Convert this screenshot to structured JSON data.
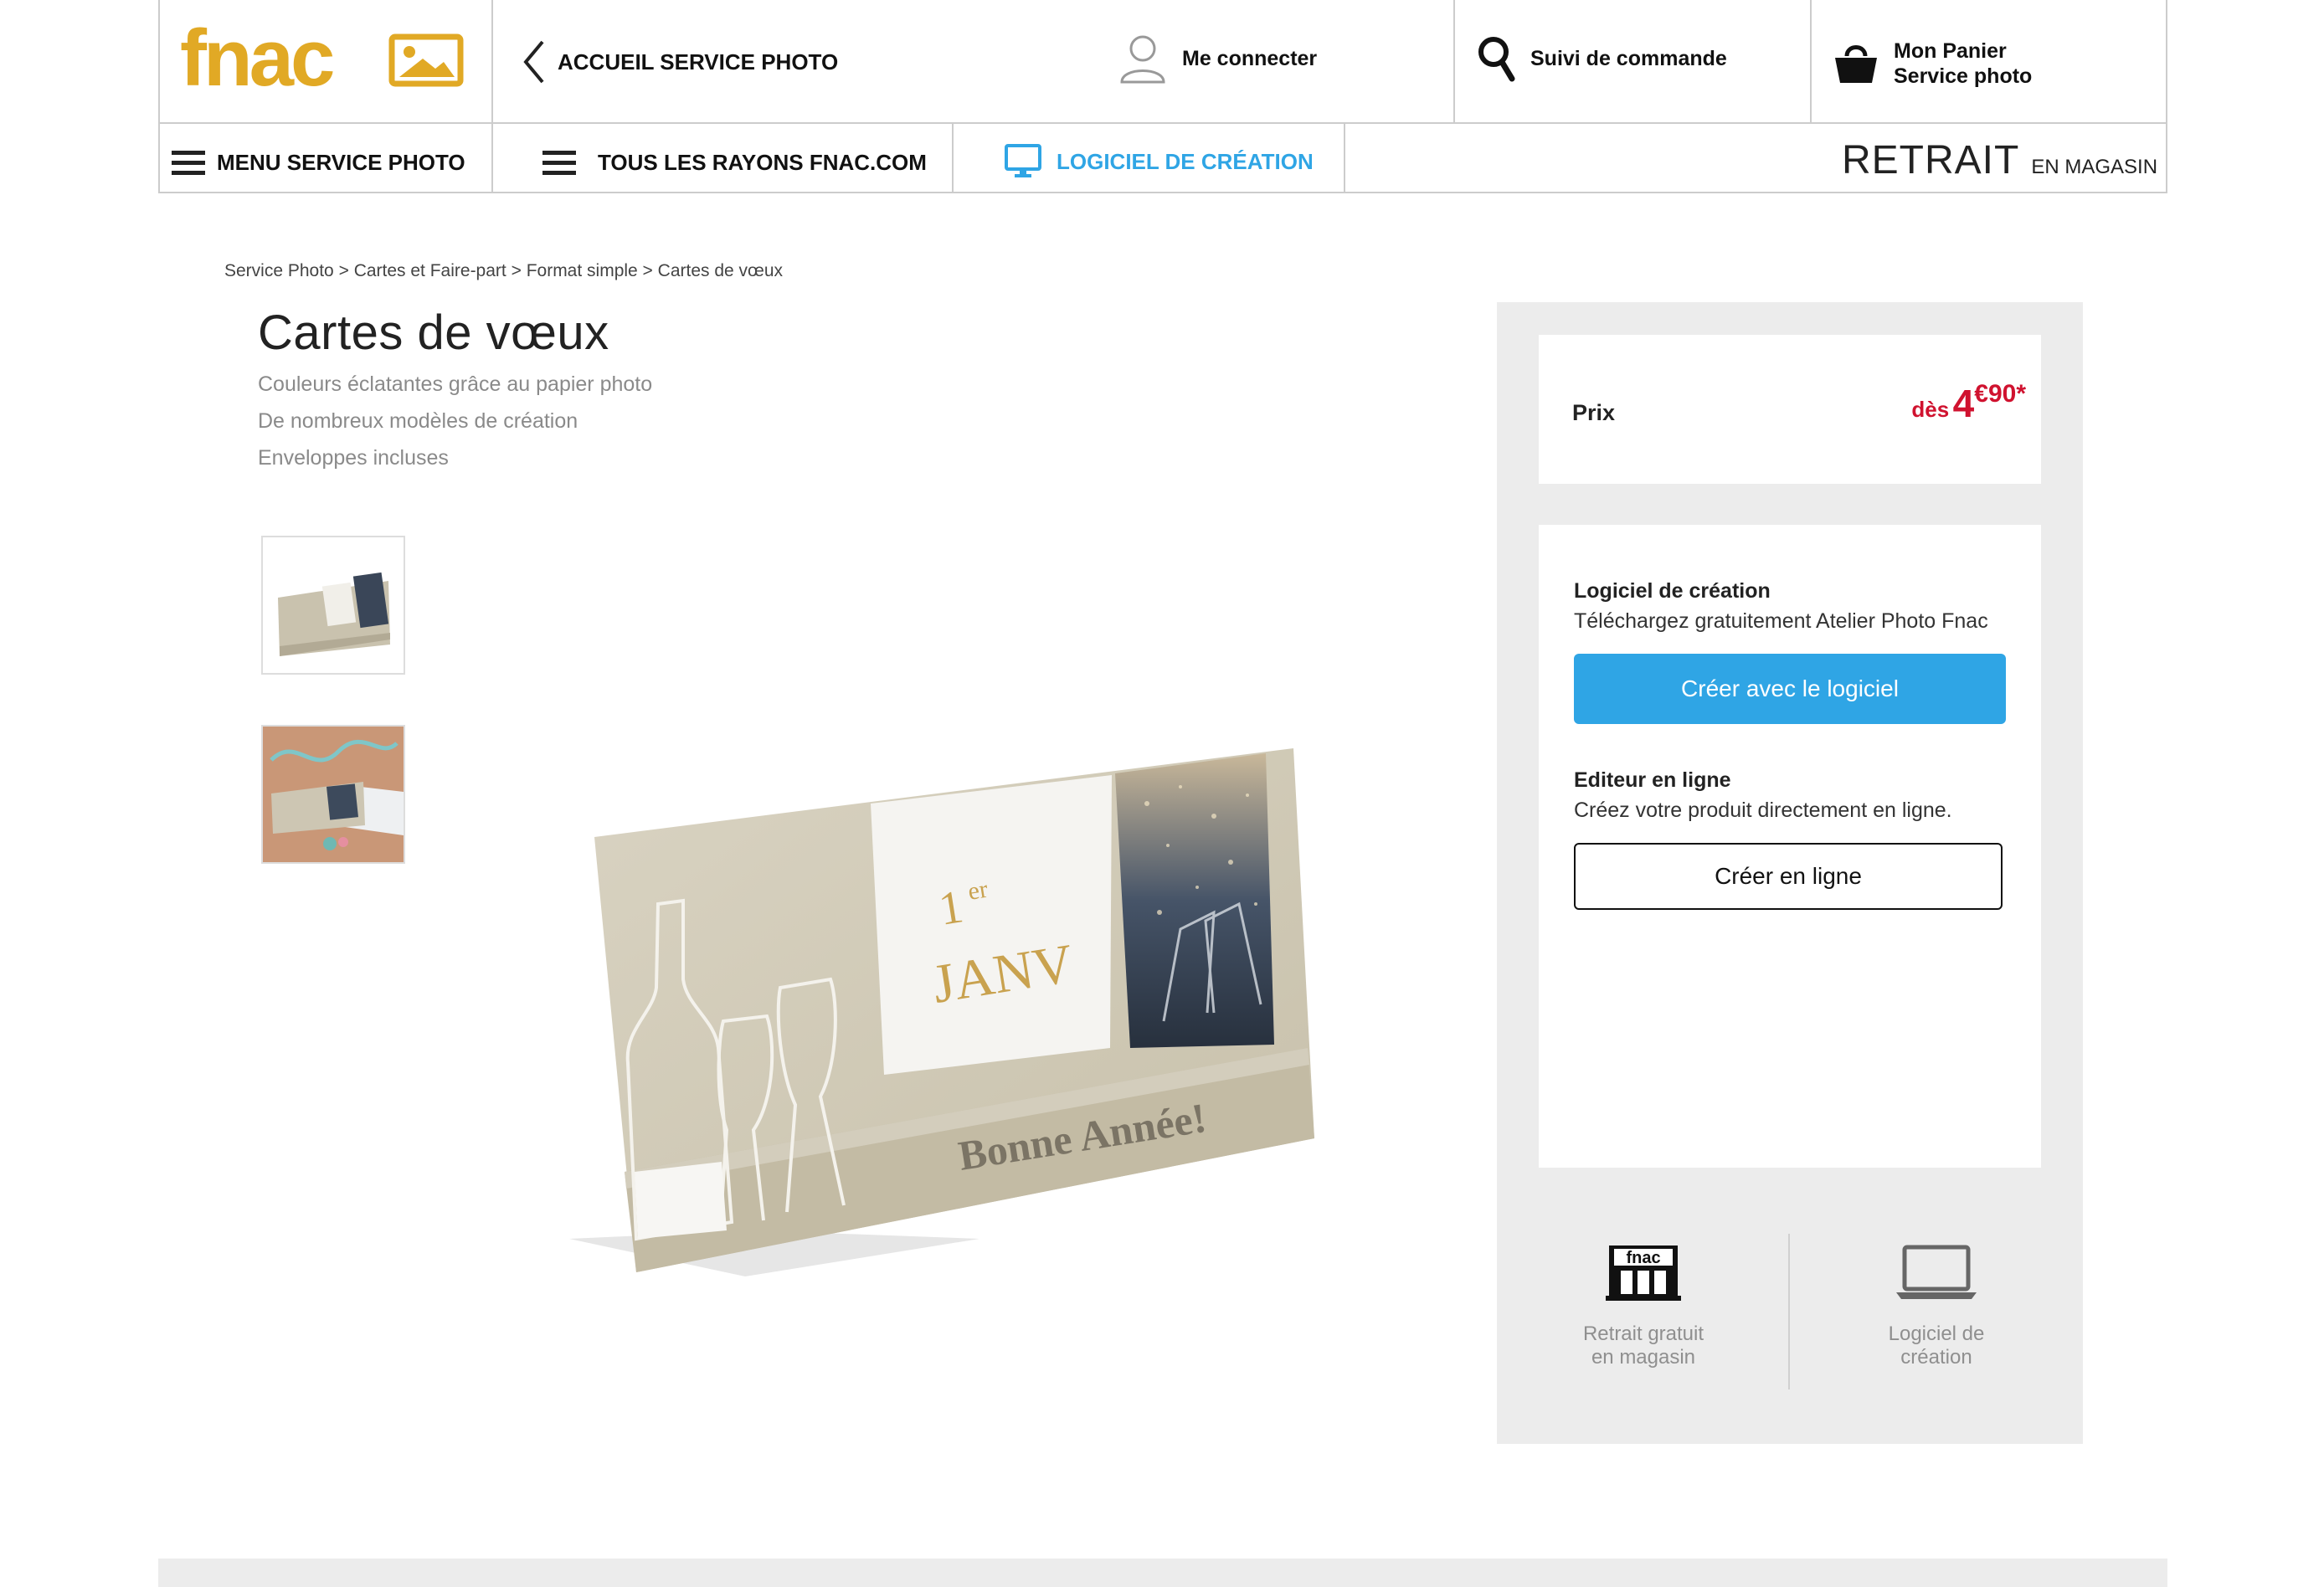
{
  "header": {
    "logo_text": "fnac",
    "back_link": "ACCUEIL SERVICE PHOTO",
    "login": "Me connecter",
    "order_tracking": "Suivi de commande",
    "cart_line1": "Mon Panier",
    "cart_line2": "Service photo"
  },
  "nav": {
    "menu": "MENU SERVICE PHOTO",
    "all_departments": "TOUS LES RAYONS FNAC.COM",
    "software": "LOGICIEL DE CRÉATION",
    "pickup_big": "RETRAIT",
    "pickup_small": "EN MAGASIN"
  },
  "breadcrumb": {
    "items": [
      "Service Photo",
      "Cartes et Faire-part",
      "Format simple",
      "Cartes de vœux"
    ],
    "separator": " > "
  },
  "product": {
    "title": "Cartes de vœux",
    "features": [
      "Couleurs éclatantes grâce au papier photo",
      "De nombreux modèles de création",
      "Enveloppes incluses"
    ],
    "card_text_1er": "1",
    "card_text_er": "er",
    "card_text_janv": "JANV",
    "card_text_greeting": "Bonne Année!"
  },
  "price": {
    "label": "Prix",
    "prefix": "dès",
    "integer": "4",
    "decimal": "€90*"
  },
  "creation": {
    "software_title": "Logiciel de création",
    "software_desc": "Téléchargez gratuitement Atelier Photo Fnac",
    "software_button": "Créer avec le logiciel",
    "online_title": "Editeur en ligne",
    "online_desc": "Créez votre produit directement en ligne.",
    "online_button": "Créer en ligne"
  },
  "services": {
    "store_logo_text": "fnac",
    "store_line1": "Retrait gratuit",
    "store_line2": "en magasin",
    "software_line1": "Logiciel de",
    "software_line2": "création"
  },
  "colors": {
    "accent_blue": "#2fa5e5",
    "nav_blue": "#2fa5e5",
    "price_red": "#d0122f",
    "fnac_yellow": "#e1a925"
  }
}
